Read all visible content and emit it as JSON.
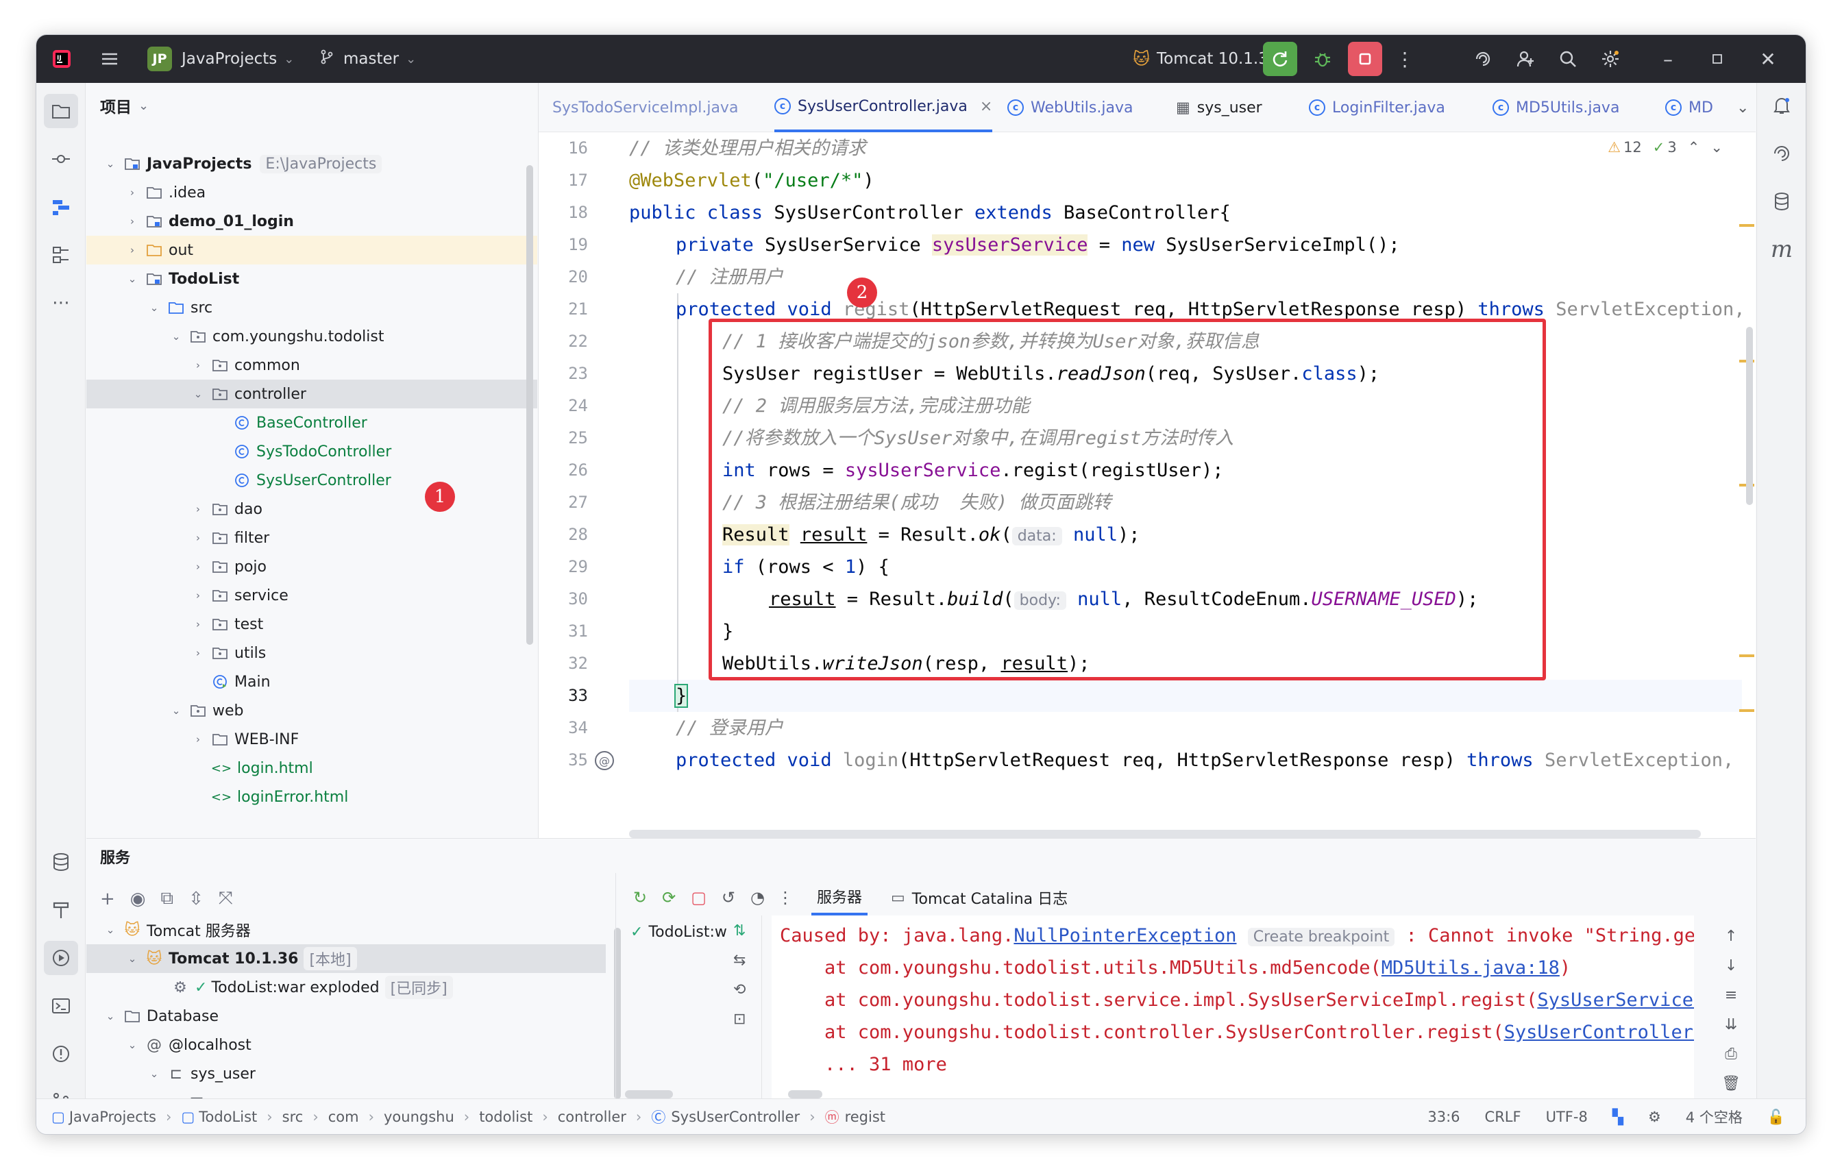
{
  "titlebar": {
    "project_badge": "JP",
    "project": "JavaProjects",
    "branch": "master",
    "run_config": "Tomcat 10.1.36"
  },
  "project_panel": {
    "title": "项目",
    "items": [
      {
        "label": "JavaProjects",
        "hint": "E:\\JavaProjects"
      },
      {
        "label": ".idea"
      },
      {
        "label": "demo_01_login"
      },
      {
        "label": "out"
      },
      {
        "label": "TodoList"
      },
      {
        "label": "src"
      },
      {
        "label": "com.youngshu.todolist"
      },
      {
        "label": "common"
      },
      {
        "label": "controller"
      },
      {
        "label": "BaseController"
      },
      {
        "label": "SysTodoController"
      },
      {
        "label": "SysUserController"
      },
      {
        "label": "dao"
      },
      {
        "label": "filter"
      },
      {
        "label": "pojo"
      },
      {
        "label": "service"
      },
      {
        "label": "test"
      },
      {
        "label": "utils"
      },
      {
        "label": "Main"
      },
      {
        "label": "web"
      },
      {
        "label": "WEB-INF"
      },
      {
        "label": "login.html"
      },
      {
        "label": "loginError.html"
      }
    ]
  },
  "tabs": [
    {
      "label": "SysTodoServiceImpl.java"
    },
    {
      "label": "SysUserController.java"
    },
    {
      "label": "WebUtils.java"
    },
    {
      "label": "sys_user"
    },
    {
      "label": "LoginFilter.java"
    },
    {
      "label": "MD5Utils.java"
    },
    {
      "label": "MD"
    }
  ],
  "inspections": {
    "warnings": "12",
    "ok": "3"
  },
  "editor": {
    "line_numbers": [
      "16",
      "17",
      "18",
      "19",
      "20",
      "21",
      "22",
      "23",
      "24",
      "25",
      "26",
      "27",
      "28",
      "29",
      "30",
      "31",
      "32",
      "33",
      "34",
      "35"
    ],
    "lines": {
      "l16": "// 该类处理用户相关的请求",
      "l17_a": "@WebServlet",
      "l17_b": "(",
      "l17_c": "\"/user/*\"",
      "l17_d": ")",
      "l18_a": "public class",
      "l18_b": " SysUserController ",
      "l18_c": "extends",
      "l18_d": " BaseController{",
      "l19_a": "private",
      "l19_b": " SysUserService ",
      "l19_c": "sysUserService",
      "l19_d": " = ",
      "l19_e": "new",
      "l19_f": " SysUserServiceImpl();",
      "l20": "// 注册用户",
      "l21_a": "protected void",
      "l21_b": " regist",
      "l21_c": "(HttpServletRequest req, HttpServletResponse resp) ",
      "l21_d": "throws",
      "l21_e": " ServletException,",
      "l22": "// 1 接收客户端提交的json参数,并转换为User对象,获取信息",
      "l23_a": "SysUser ",
      "l23_b": "registUser",
      "l23_c": " = WebUtils.",
      "l23_d": "readJson",
      "l23_e": "(req, SysUser.",
      "l23_f": "class",
      "l23_g": ");",
      "l24": "// 2 调用服务层方法,完成注册功能",
      "l25": "//将参数放入一个SysUser对象中,在调用regist方法时传入",
      "l26_a": "int",
      "l26_b": " rows = ",
      "l26_c": "sysUserService",
      "l26_d": ".regist(registUser);",
      "l27": "// 3 根据注册结果(成功  失败) 做页面跳转",
      "l28_a": "Result",
      "l28_b": " ",
      "l28_c": "result",
      "l28_d": " = Result.",
      "l28_e": "ok",
      "l28_f": "(",
      "l28_hint": "data:",
      "l28_g": "null",
      "l28_h": ");",
      "l29_a": "if",
      "l29_b": " (rows < ",
      "l29_c": "1",
      "l29_d": ") {",
      "l30_a": "result",
      "l30_b": " = Result.",
      "l30_c": "build",
      "l30_d": "(",
      "l30_hint": "body:",
      "l30_e": "null",
      "l30_f": ", ResultCodeEnum.",
      "l30_g": "USERNAME_USED",
      "l30_h": ");",
      "l31": "}",
      "l32_a": "WebUtils.",
      "l32_b": "writeJson",
      "l32_c": "(resp, ",
      "l32_d": "result",
      "l32_e": ");",
      "l33": "}",
      "l34": "// 登录用户",
      "l35_a": "protected void",
      "l35_b": " login",
      "l35_c": "(HttpServletRequest req, HttpServletResponse resp) ",
      "l35_d": "throws",
      "l35_e": " ServletException,"
    }
  },
  "annotations": {
    "badge1": "1",
    "badge2": "2"
  },
  "services": {
    "title": "服务",
    "tree": [
      {
        "label": "Tomcat 服务器"
      },
      {
        "label": "Tomcat 10.1.36",
        "hint": "[本地]"
      },
      {
        "label": "TodoList:war exploded",
        "hint": "[已同步]"
      },
      {
        "label": "Database"
      },
      {
        "label": "@localhost"
      },
      {
        "label": "sys_user"
      },
      {
        "label": "sys_user"
      }
    ],
    "console_tabs": [
      "服务器",
      "Tomcat Catalina 日志"
    ],
    "deployment": "TodoList:w",
    "console": {
      "c1_a": "Caused by: java.lang.",
      "c1_b": "NullPointerException",
      "c1_hint": "Create breakpoint",
      "c1_c": " : Cannot invoke \"String.get",
      "c2_a": "    at com.youngshu.todolist.utils.MD5Utils.md5encode(",
      "c2_b": "MD5Utils.java:18",
      "c2_c": ")",
      "c3_a": "    at com.youngshu.todolist.service.impl.SysUserServiceImpl.regist(",
      "c3_b": "SysUserServiceI",
      "c4_a": "    at com.youngshu.todolist.controller.SysUserController.regist(",
      "c4_b": "SysUserController.",
      "c5": "    ... 31 more"
    }
  },
  "statusbar": {
    "crumbs": [
      "JavaProjects",
      "TodoList",
      "src",
      "com",
      "youngshu",
      "todolist",
      "controller",
      "SysUserController",
      "regist"
    ],
    "position": "33:6",
    "line_sep": "CRLF",
    "encoding": "UTF-8",
    "indent": "4 个空格"
  }
}
